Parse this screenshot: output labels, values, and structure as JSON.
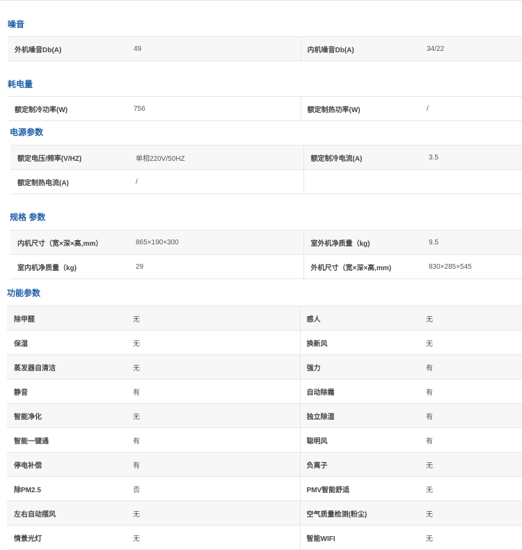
{
  "sections": [
    {
      "title": "噪音",
      "rows": [
        [
          "外机噪音Db(A)",
          "49",
          "内机噪音Db(A)",
          "34/22"
        ]
      ]
    },
    {
      "title": "耗电量",
      "rows": [
        [
          "额定制冷功率(W)",
          "756",
          "额定制热功率(W)",
          "/"
        ]
      ]
    },
    {
      "title": "电源参数",
      "rows": [
        [
          "额定电压/频率(V/HZ)",
          "单相220V/50HZ",
          "额定制冷电流(A)",
          "3.5"
        ],
        [
          "额定制热电流(A)",
          "/",
          "",
          ""
        ]
      ]
    },
    {
      "title": "规格 参数",
      "rows": [
        [
          "内机尺寸（宽×深×高,mm）",
          "865×190×300",
          "室外机净质量（kg)",
          "9.5"
        ],
        [
          "室内机净质量（kg)",
          "29",
          "外机尺寸（宽×深×高,mm)",
          "830×285×545"
        ]
      ]
    },
    {
      "title": "功能参数",
      "rows": [
        [
          "除甲醛",
          "无",
          "感人",
          "无"
        ],
        [
          "保湿",
          "无",
          "换新风",
          "无"
        ],
        [
          "蒸发器自清洁",
          "无",
          "强力",
          "有"
        ],
        [
          "静音",
          "有",
          "自动除霜",
          "有"
        ],
        [
          "智能净化",
          "无",
          "独立除湿",
          "有"
        ],
        [
          "智能一键通",
          "有",
          "聪明风",
          "有"
        ],
        [
          "停电补偿",
          "有",
          "负离子",
          "无"
        ],
        [
          "除PM2.5",
          "否",
          "PMV智能舒适",
          "无"
        ],
        [
          "左右自动摆风",
          "无",
          "空气质量检测(粉尘)",
          "无"
        ],
        [
          "情景光灯",
          "无",
          "智能WIFI",
          "无"
        ]
      ]
    }
  ]
}
